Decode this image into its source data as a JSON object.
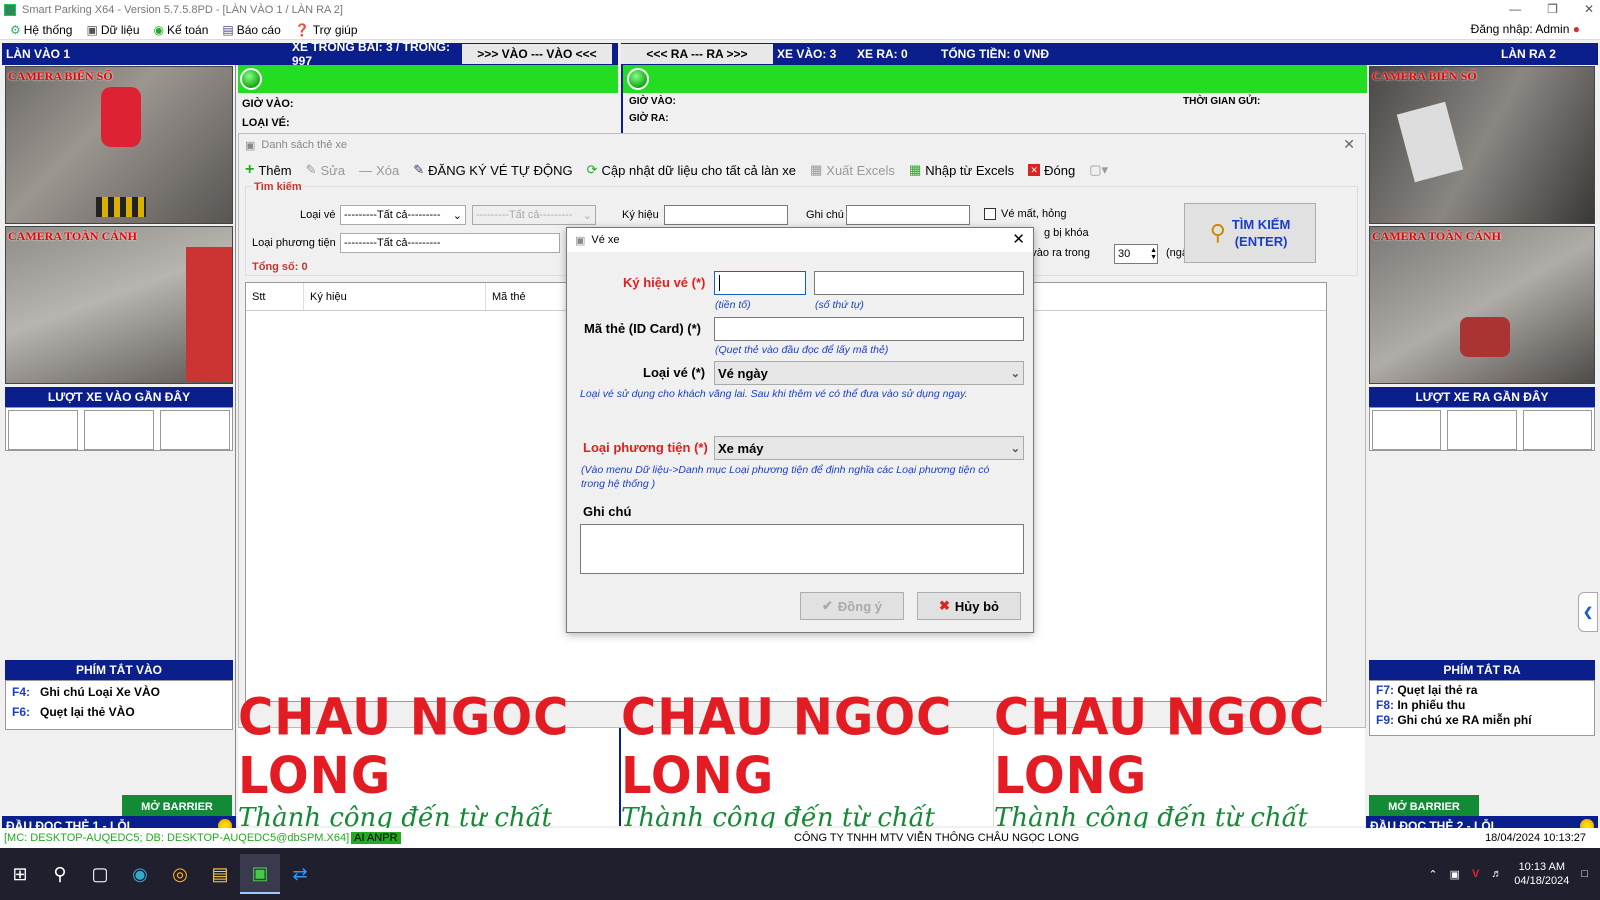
{
  "window": {
    "title": "Smart Parking X64 - Version 5.7.5.8PD - [LÀN VÀO 1 / LÀN RA 2]"
  },
  "menu": {
    "items": [
      "Hệ thống",
      "Dữ liệu",
      "Kế toán",
      "Báo cáo",
      "Trợ giúp"
    ],
    "login": "Đăng nhập: Admin"
  },
  "lane_in": {
    "title": "LÀN VÀO 1",
    "stats": "XE TRONG BÃI: 3 / TRỐNG: 997",
    "tab": ">>> VÀO  ---  VÀO <<<",
    "cam1": "CAMERA BIỂN SỐ",
    "cam2": "CAMERA TOÀN CẢNH",
    "gio_vao": "GIỜ VÀO:",
    "loai_ve": "LOẠI VÉ:",
    "recent": "LƯỢT XE VÀO GẦN ĐÂY",
    "hotkeys_title": "PHÍM TẮT VÀO",
    "hotkeys": [
      {
        "key": "F4:",
        "label": "Ghi chú Loại Xe VÀO"
      },
      {
        "key": "F6:",
        "label": "Quẹt lại thẻ VÀO"
      }
    ],
    "barrier": "MỞ BARRIER",
    "reader": "ĐẦU ĐỌC THẺ 1 - LỖI"
  },
  "lane_out": {
    "title": "LÀN RA 2",
    "tab": "<<< RA  ---  RA >>>",
    "xe_vao": "XE VÀO: 3",
    "xe_ra": "XE RA: 0",
    "tong_tien": "TỔNG TIỀN: 0 VNĐ",
    "gio_vao": "GIỜ VÀO:",
    "gio_ra": "GIỜ RA:",
    "thoi_gian_gui": "THỜI GIAN GỬI:",
    "cam1": "CAMERA BIỂN SỐ",
    "cam2": "CAMERA TOÀN CẢNH",
    "recent": "LƯỢT XE RA GẦN ĐÂY",
    "hotkeys_title": "PHÍM TẮT RA",
    "hotkeys": [
      {
        "key": "F7:",
        "label": "Quẹt lại thẻ ra"
      },
      {
        "key": "F8:",
        "label": "In phiếu thu"
      },
      {
        "key": "F9:",
        "label": "Ghi chú xe RA miễn phí"
      }
    ],
    "barrier": "MỞ BARRIER",
    "reader": "ĐẦU ĐỌC THẺ 2 - LỖI"
  },
  "card_list": {
    "title": "Danh sách thẻ xe",
    "toolbar": [
      "Thêm",
      "Sửa",
      "Xóa",
      "ĐĂNG KÝ VÉ TỰ ĐỘNG",
      "Cập nhật dữ liệu cho tất cả làn xe",
      "Xuất Excels",
      "Nhập từ Excels",
      "Đóng"
    ],
    "search_group": "Tìm kiếm",
    "loai_ve_label": "Loại vé",
    "loai_ve_value": "---------Tất cả---------",
    "loai_ve_value2": "---------Tất cả---------",
    "ky_hieu_label": "Ký hiệu",
    "ghi_chu_label": "Ghi chú",
    "ve_mat_hong": "Vé mất, hỏng",
    "bi_khoa": "g bị khóa",
    "vao_ra_trong": "ng vào ra trong",
    "days_value": "30",
    "days_unit": "(ngày)",
    "loai_pt_label": "Loại phương tiện",
    "loai_pt_value": "---------Tất cả---------",
    "tong_so": "Tổng số: 0",
    "search_btn_line1": "TÌM KIẾM",
    "search_btn_line2": "(ENTER)",
    "columns": [
      "Stt",
      "Ký hiệu",
      "Mã thẻ"
    ]
  },
  "ticket_dialog": {
    "title": "Vé xe",
    "ky_hieu_label": "Ký hiệu vé (*)",
    "tien_to": "(tiền tố)",
    "so_thu_tu": "(số thứ tự)",
    "ma_the_label": "Mã thẻ (ID Card) (*)",
    "ma_the_hint": "(Quẹt thẻ vào đầu đọc để lấy mã thẻ)",
    "loai_ve_label": "Loại vé (*)",
    "loai_ve_value": "Vé ngày",
    "loai_ve_hint": "Loại vé sử dụng cho khách vãng lai. Sau khi thêm vé có thể đưa vào sử dụng ngay.",
    "loai_pt_label": "Loại phương tiện (*)",
    "loai_pt_value": "Xe máy",
    "loai_pt_hint": "(Vào menu Dữ liệu->Danh mục Loại phương tiện để định nghĩa các Loại phương tiện có trong hệ thống )",
    "ghi_chu_label": "Ghi chú",
    "ok": "Đồng ý",
    "cancel": "Hủy bỏ"
  },
  "banner": {
    "brand": "CHAU NGOC LONG",
    "slogan": "Thành công đến từ chất lượng"
  },
  "status": {
    "machine": "[MC: DESKTOP-AUQEDC5; DB: DESKTOP-AUQEDC5@dbSPM.X64]",
    "anpr": "AI ANPR",
    "company": "CÔNG TY TNHH MTV VIỄN THÔNG CHÂU NGỌC LONG",
    "datetime": "18/04/2024 10:13:27"
  },
  "taskbar": {
    "time": "10:13 AM",
    "date": "04/18/2024"
  },
  "colors": {
    "lane_blue": "#0a1e8c",
    "green_bar": "#22dd22",
    "brand_red": "#e31b23",
    "hint_blue": "#1a3fc6"
  }
}
